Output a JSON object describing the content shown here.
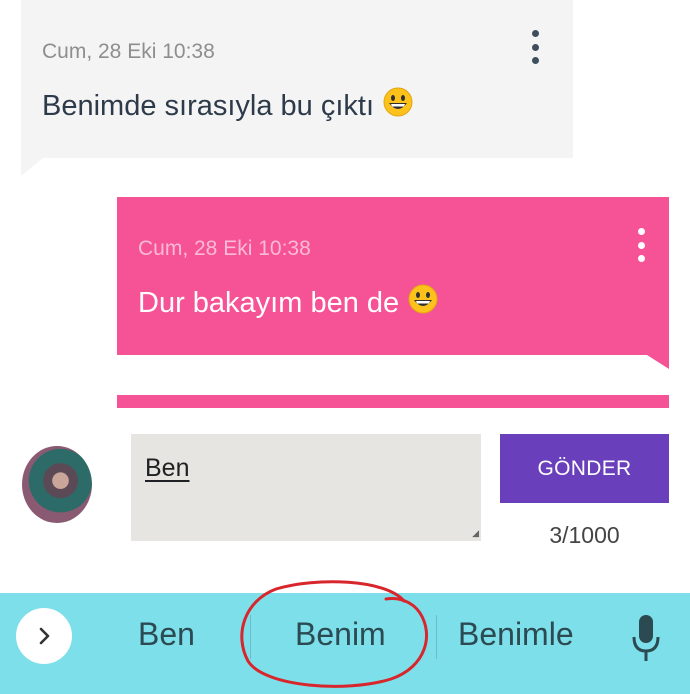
{
  "messages": [
    {
      "direction": "received",
      "timestamp": "Cum, 28 Eki 10:38",
      "text": "Benimde sırasıyla bu çıktı",
      "emoji": "grinning-face",
      "color": "#f4f4f4"
    },
    {
      "direction": "sent",
      "timestamp": "Cum, 28 Eki 10:38",
      "text": "Dur bakayım ben de",
      "emoji": "grinning-face",
      "color": "#f65396"
    }
  ],
  "composer": {
    "input_value": "Ben",
    "send_label": "GÖNDER",
    "counter": "3/1000",
    "send_color": "#6a3fbb"
  },
  "keyboard": {
    "background": "#7ddfe9",
    "suggestions": [
      "Ben",
      "Benim",
      "Benimle"
    ],
    "highlighted_suggestion": "Benim",
    "annotation_color": "#d8262d"
  }
}
